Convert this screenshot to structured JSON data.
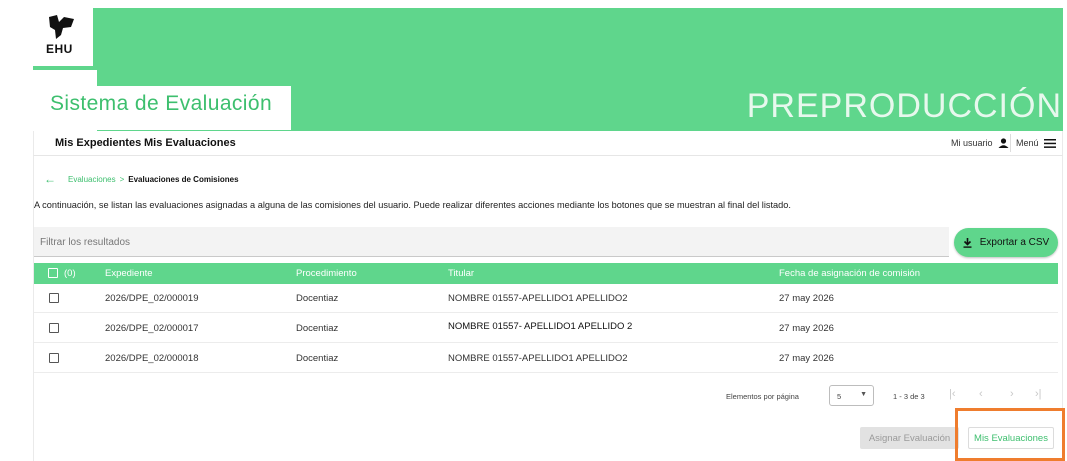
{
  "brand": {
    "logo_text": "EHU",
    "app_title": "Sistema de Evaluación",
    "environment": "PREPRODUCCIÓN"
  },
  "nav": {
    "items": [
      {
        "label": "Mis Expedientes"
      },
      {
        "label": "Mis Evaluaciones"
      }
    ],
    "user_label": "Mi usuario",
    "menu_label": "Menú"
  },
  "breadcrumb": {
    "parent": "Evaluaciones",
    "separator": ">",
    "current": "Evaluaciones de Comisiones"
  },
  "description": "A continuación, se listan las evaluaciones asignadas a alguna de las comisiones del usuario. Puede realizar diferentes acciones mediante los botones que se muestran al final del listado.",
  "filter": {
    "placeholder": "Filtrar los resultados"
  },
  "export_button": {
    "label": "Exportar a CSV"
  },
  "table": {
    "selected_count": "(0)",
    "headers": {
      "expediente": "Expediente",
      "procedimiento": "Procedimiento",
      "titular": "Titular",
      "fecha": "Fecha de asignación de comisión"
    },
    "rows": [
      {
        "expediente": "2026/DPE_02/000019",
        "procedimiento": "Docentiaz",
        "titular": "NOMBRE 01557-APELLIDO1 APELLIDO2",
        "fecha": "27 may 2026"
      },
      {
        "expediente": "2026/DPE_02/000017",
        "procedimiento": "Docentiaz",
        "titular": "NOMBRE 01557- APELLIDO1 APELLIDO 2",
        "fecha": "27 may 2026"
      },
      {
        "expediente": "2026/DPE_02/000018",
        "procedimiento": "Docentiaz",
        "titular": "NOMBRE 01557-APELLIDO1 APELLIDO2",
        "fecha": "27 may 2026"
      }
    ]
  },
  "paginator": {
    "label": "Elementos por página",
    "page_size": "5",
    "range": "1 - 3 de 3"
  },
  "actions": {
    "assign_label": "Asignar Evaluación",
    "mis_evaluaciones_label": "Mis Evaluaciones"
  },
  "colors": {
    "brand_green": "#5fd68c",
    "accent_green": "#3dbf6e",
    "highlight": "#ef7d2e"
  }
}
